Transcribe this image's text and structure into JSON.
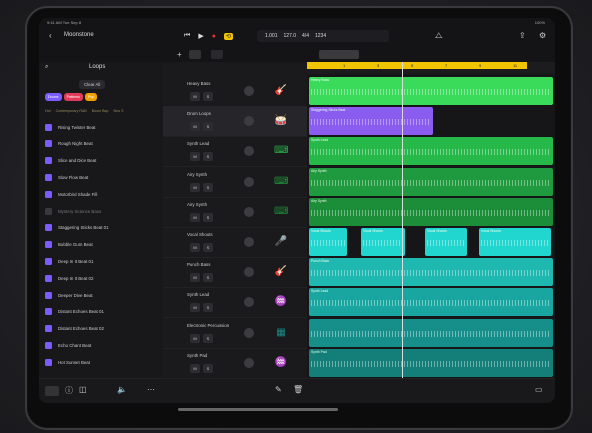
{
  "status": {
    "time": "9:41 AM",
    "date": "Tue Sep 8",
    "battery": "100%"
  },
  "project": {
    "name": "Moonstone"
  },
  "lcd": {
    "position": "1.001",
    "tempo": "127.0",
    "signature": "4/4",
    "key": "C maj",
    "count": "1234"
  },
  "loops_panel": {
    "title": "Loops",
    "filter_label": "Clear All",
    "chips": [
      {
        "label": "Drums",
        "color": "#7c5cff"
      },
      {
        "label": "Patterns",
        "color": "#e23a5a"
      },
      {
        "label": "Pop",
        "color": "#f0a000"
      }
    ],
    "subtabs": [
      "Hot",
      "Contemporary R&B",
      "Boom Bap",
      "Neo S"
    ],
    "items": [
      {
        "label": "Rising Twister Beat",
        "dim": false
      },
      {
        "label": "Rough Night Beat",
        "dim": false
      },
      {
        "label": "Slice and Dice Beat",
        "dim": false
      },
      {
        "label": "Slow Flow Beat",
        "dim": false
      },
      {
        "label": "Motorbird Shade Fill",
        "dim": false
      },
      {
        "label": "Mystery Science Bass",
        "dim": true
      },
      {
        "label": "Staggering Sticks Beat 01",
        "dim": false
      },
      {
        "label": "Bubble Gum Beat",
        "dim": false
      },
      {
        "label": "Deep In It Beat 01",
        "dim": false
      },
      {
        "label": "Deep In It Beat 02",
        "dim": false
      },
      {
        "label": "Deeper Dive Beat",
        "dim": false
      },
      {
        "label": "Distant Echoes Beat 01",
        "dim": false
      },
      {
        "label": "Distant Echoes Beat 02",
        "dim": false
      },
      {
        "label": "Echo Chant Beat",
        "dim": false
      },
      {
        "label": "Hot Sunset Beat",
        "dim": false
      }
    ]
  },
  "ruler": {
    "marks": [
      "1",
      "3",
      "5",
      "7",
      "9",
      "11",
      "13"
    ]
  },
  "tracks": [
    {
      "name": "Heavy Bass",
      "icon": "guitar-icon",
      "color": "#3adb5a",
      "region": "Heavy Bass"
    },
    {
      "name": "Drum Loops",
      "icon": "drums-icon",
      "color": "#8a5cf0",
      "region": "Staggering Sticks Beat"
    },
    {
      "name": "Synth Lead",
      "icon": "keyboard-icon",
      "color": "#27b84a",
      "region": "Synth Lead"
    },
    {
      "name": "Airy Synth",
      "icon": "keyboard-icon",
      "color": "#1f9a3e",
      "region": "Airy Synth"
    },
    {
      "name": "Airy Synth",
      "icon": "keyboard-icon",
      "color": "#1c8d38",
      "region": "Airy Synth"
    },
    {
      "name": "Vocal Shouts",
      "icon": "mic-icon",
      "color": "#22d6d0",
      "region": "Vocal Shouts"
    },
    {
      "name": "Punch Bass",
      "icon": "guitar-icon",
      "color": "#1fb8b0",
      "region": "Punch Bass"
    },
    {
      "name": "Synth Lead",
      "icon": "synth-icon",
      "color": "#1aa6a0",
      "region": "Synth Lead"
    },
    {
      "name": "Electronic Percussion",
      "icon": "drum-machine-icon",
      "color": "#168f8a",
      "region": ""
    },
    {
      "name": "Synth Pad",
      "icon": "synth-icon",
      "color": "#147e78",
      "region": "Synth Pad"
    }
  ]
}
